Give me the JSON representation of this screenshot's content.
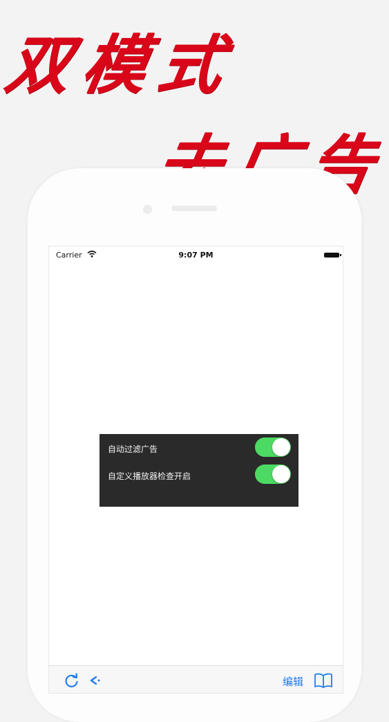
{
  "headline": {
    "line1": "双模式",
    "line2": "去广告"
  },
  "status_bar": {
    "carrier": "Carrier",
    "time": "9:07 PM"
  },
  "settings": [
    {
      "label": "自动过滤广告",
      "enabled": true
    },
    {
      "label": "自定义播放器检查开启",
      "enabled": true
    }
  ],
  "toolbar": {
    "edit_label": "编辑"
  },
  "colors": {
    "headline": "#d9061a",
    "toggle_on": "#4cd964",
    "accent": "#1f7cf2",
    "panel_bg": "#2a2a2a"
  },
  "icons": [
    "wifi-icon",
    "battery-icon",
    "refresh-icon",
    "back-icon",
    "bookmarks-icon"
  ]
}
